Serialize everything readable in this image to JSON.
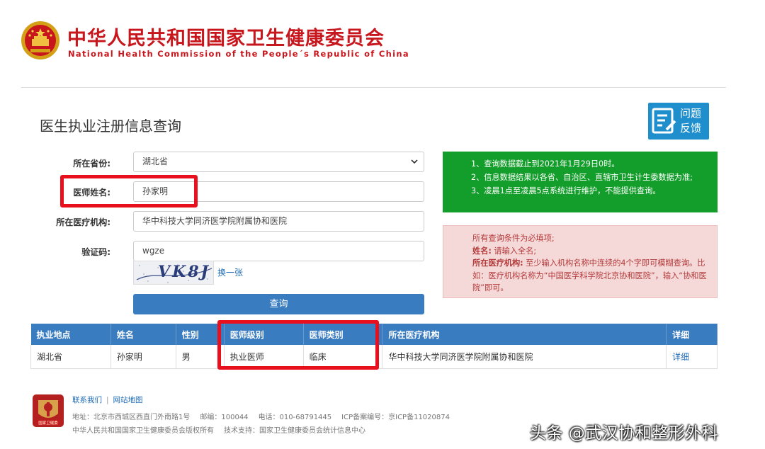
{
  "header": {
    "title_cn": "中华人民共和国国家卫生健康委员会",
    "title_en": "National Health Commission of the People´s Republic of China"
  },
  "page_title": "医生执业注册信息查询",
  "feedback": {
    "line1": "问题",
    "line2": "反馈",
    "icon": "feedback-form-icon"
  },
  "form": {
    "province_label": "所在省份:",
    "province_value": "湖北省",
    "doctor_name_label": "医师姓名:",
    "doctor_name_value": "孙家明",
    "institution_label": "所在医疗机构:",
    "institution_value": "华中科技大学同济医学院附属协和医院",
    "captcha_label": "验证码:",
    "captcha_value": "wgze",
    "captcha_image_text": "VK8J",
    "captcha_refresh": "换一张",
    "submit_label": "查询"
  },
  "notice_green": {
    "items": [
      "1、查询数据截止到2021年1月29日0时。",
      "2、信息数据结果以各省、自治区、直辖市卫生计生委数据为准;",
      "3、凌晨1点至凌晨5点系统进行维护，不能提供查询。"
    ]
  },
  "notice_pink": {
    "line1": "所有查询条件为必填项;",
    "name_key": "姓名:",
    "name_text": "请输入全名;",
    "inst_key": "所在医疗机构:",
    "inst_text": "至少输入机构名称中连续的4个字即可模糊查询。比如：医疗机构名称为“中国医学科学院北京协和医院”，输入“协和医院”即可。"
  },
  "table": {
    "headers": [
      "执业地点",
      "姓名",
      "性别",
      "医师级别",
      "医师类别",
      "所在医疗机构",
      "详细"
    ],
    "rows": [
      [
        "湖北省",
        "孙家明",
        "男",
        "执业医师",
        "临床",
        "华中科技大学同济医学院附属协和医院",
        "详细"
      ]
    ]
  },
  "footer": {
    "contact": "联系我们",
    "sitemap": "网站地图",
    "logo_text": "国家卫健委",
    "address": "地址：北京市西城区西直门外南路1号",
    "postcode": "邮编：100044",
    "phone": "电话：010-68791445",
    "icp": "ICP备案编号：京ICP备11020874",
    "copyright": "中华人民共和国国家卫生健康委员会版权所有",
    "support": "技术支持：国家卫生健康委员会统计信息中心"
  },
  "watermark": "头条 @武汉协和整形外科",
  "colors": {
    "brand_red": "#c8161d",
    "primary_blue": "#3a7cc0",
    "notice_green": "#139d2a",
    "notice_pink": "#f5d9d9",
    "highlight_red": "#e8101c"
  }
}
